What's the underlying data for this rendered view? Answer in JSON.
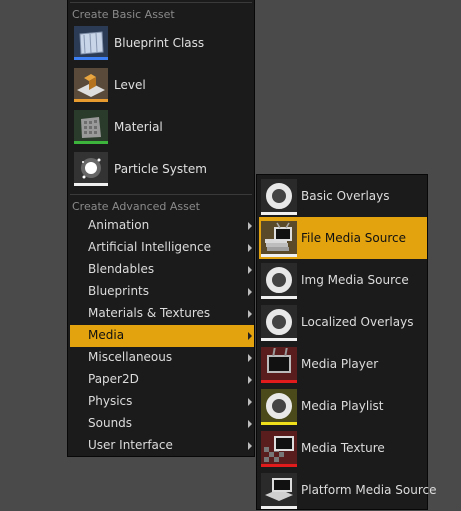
{
  "main_menu": {
    "basic_header": "Create Basic Asset",
    "basic_items": [
      {
        "label": "Blueprint Class",
        "icon": "blueprint-class-icon",
        "bar_color": "#3d7ff5"
      },
      {
        "label": "Level",
        "icon": "level-icon",
        "bar_color": "#e89b2e"
      },
      {
        "label": "Material",
        "icon": "material-icon",
        "bar_color": "#3db53d"
      },
      {
        "label": "Particle System",
        "icon": "particle-system-icon",
        "bar_color": "#f0f0f0"
      }
    ],
    "advanced_header": "Create Advanced Asset",
    "advanced_items": [
      {
        "label": "Animation"
      },
      {
        "label": "Artificial Intelligence"
      },
      {
        "label": "Blendables"
      },
      {
        "label": "Blueprints"
      },
      {
        "label": "Materials & Textures"
      },
      {
        "label": "Media",
        "selected": true
      },
      {
        "label": "Miscellaneous"
      },
      {
        "label": "Paper2D"
      },
      {
        "label": "Physics"
      },
      {
        "label": "Sounds"
      },
      {
        "label": "User Interface"
      }
    ]
  },
  "media_submenu": {
    "items": [
      {
        "label": "Basic Overlays",
        "icon": "overlay-ring-icon",
        "bar_color": "#f0f0f0"
      },
      {
        "label": "File Media Source",
        "icon": "file-media-source-icon",
        "bar_color": "#f0f0f0",
        "selected": true
      },
      {
        "label": "Img Media Source",
        "icon": "overlay-ring-icon",
        "bar_color": "#f0f0f0"
      },
      {
        "label": "Localized Overlays",
        "icon": "overlay-ring-icon",
        "bar_color": "#f0f0f0"
      },
      {
        "label": "Media Player",
        "icon": "tv-icon",
        "bar_color": "#e11b1b"
      },
      {
        "label": "Media Playlist",
        "icon": "playlist-ring-icon",
        "bar_color": "#f0e01b"
      },
      {
        "label": "Media Texture",
        "icon": "media-texture-icon",
        "bar_color": "#e11b1b"
      },
      {
        "label": "Platform Media Source",
        "icon": "platform-media-source-icon",
        "bar_color": "#f0f0f0"
      }
    ]
  }
}
